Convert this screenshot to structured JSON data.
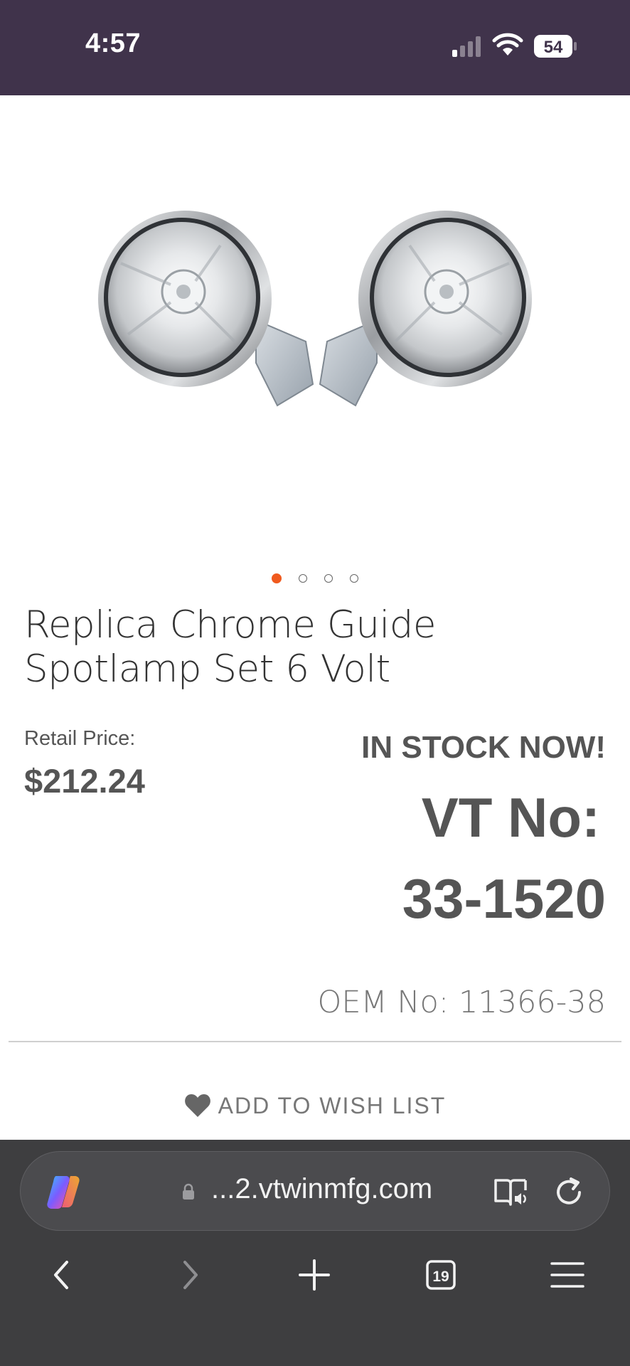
{
  "status_bar": {
    "time": "4:57",
    "battery_level": "54",
    "signal_icon": "cellular-signal-icon",
    "wifi_icon": "wifi-icon"
  },
  "carousel": {
    "image_count": 4,
    "active_index": 0,
    "image_description_icon": "spotlamp-pair-image"
  },
  "product": {
    "title_line1": "Replica Chrome Guide",
    "title_line2": "Spotlamp Set 6 Volt",
    "retail_label": "Retail Price:",
    "retail_price": "$212.24",
    "stock_status": "IN STOCK NOW!",
    "vt_label": "VT No:",
    "vt_number": "33-1520",
    "oem_label": "OEM No:",
    "oem_number": "11366-38"
  },
  "wishlist": {
    "label": "ADD TO WISH LIST",
    "icon": "heart-icon"
  },
  "browser": {
    "url": "...2.vtwinmfg.com",
    "tab_count": "19",
    "colors": {
      "chrome_background": "#3e3e40",
      "status_bar": "#40334b",
      "accent_dot": "#f05a1e"
    }
  }
}
